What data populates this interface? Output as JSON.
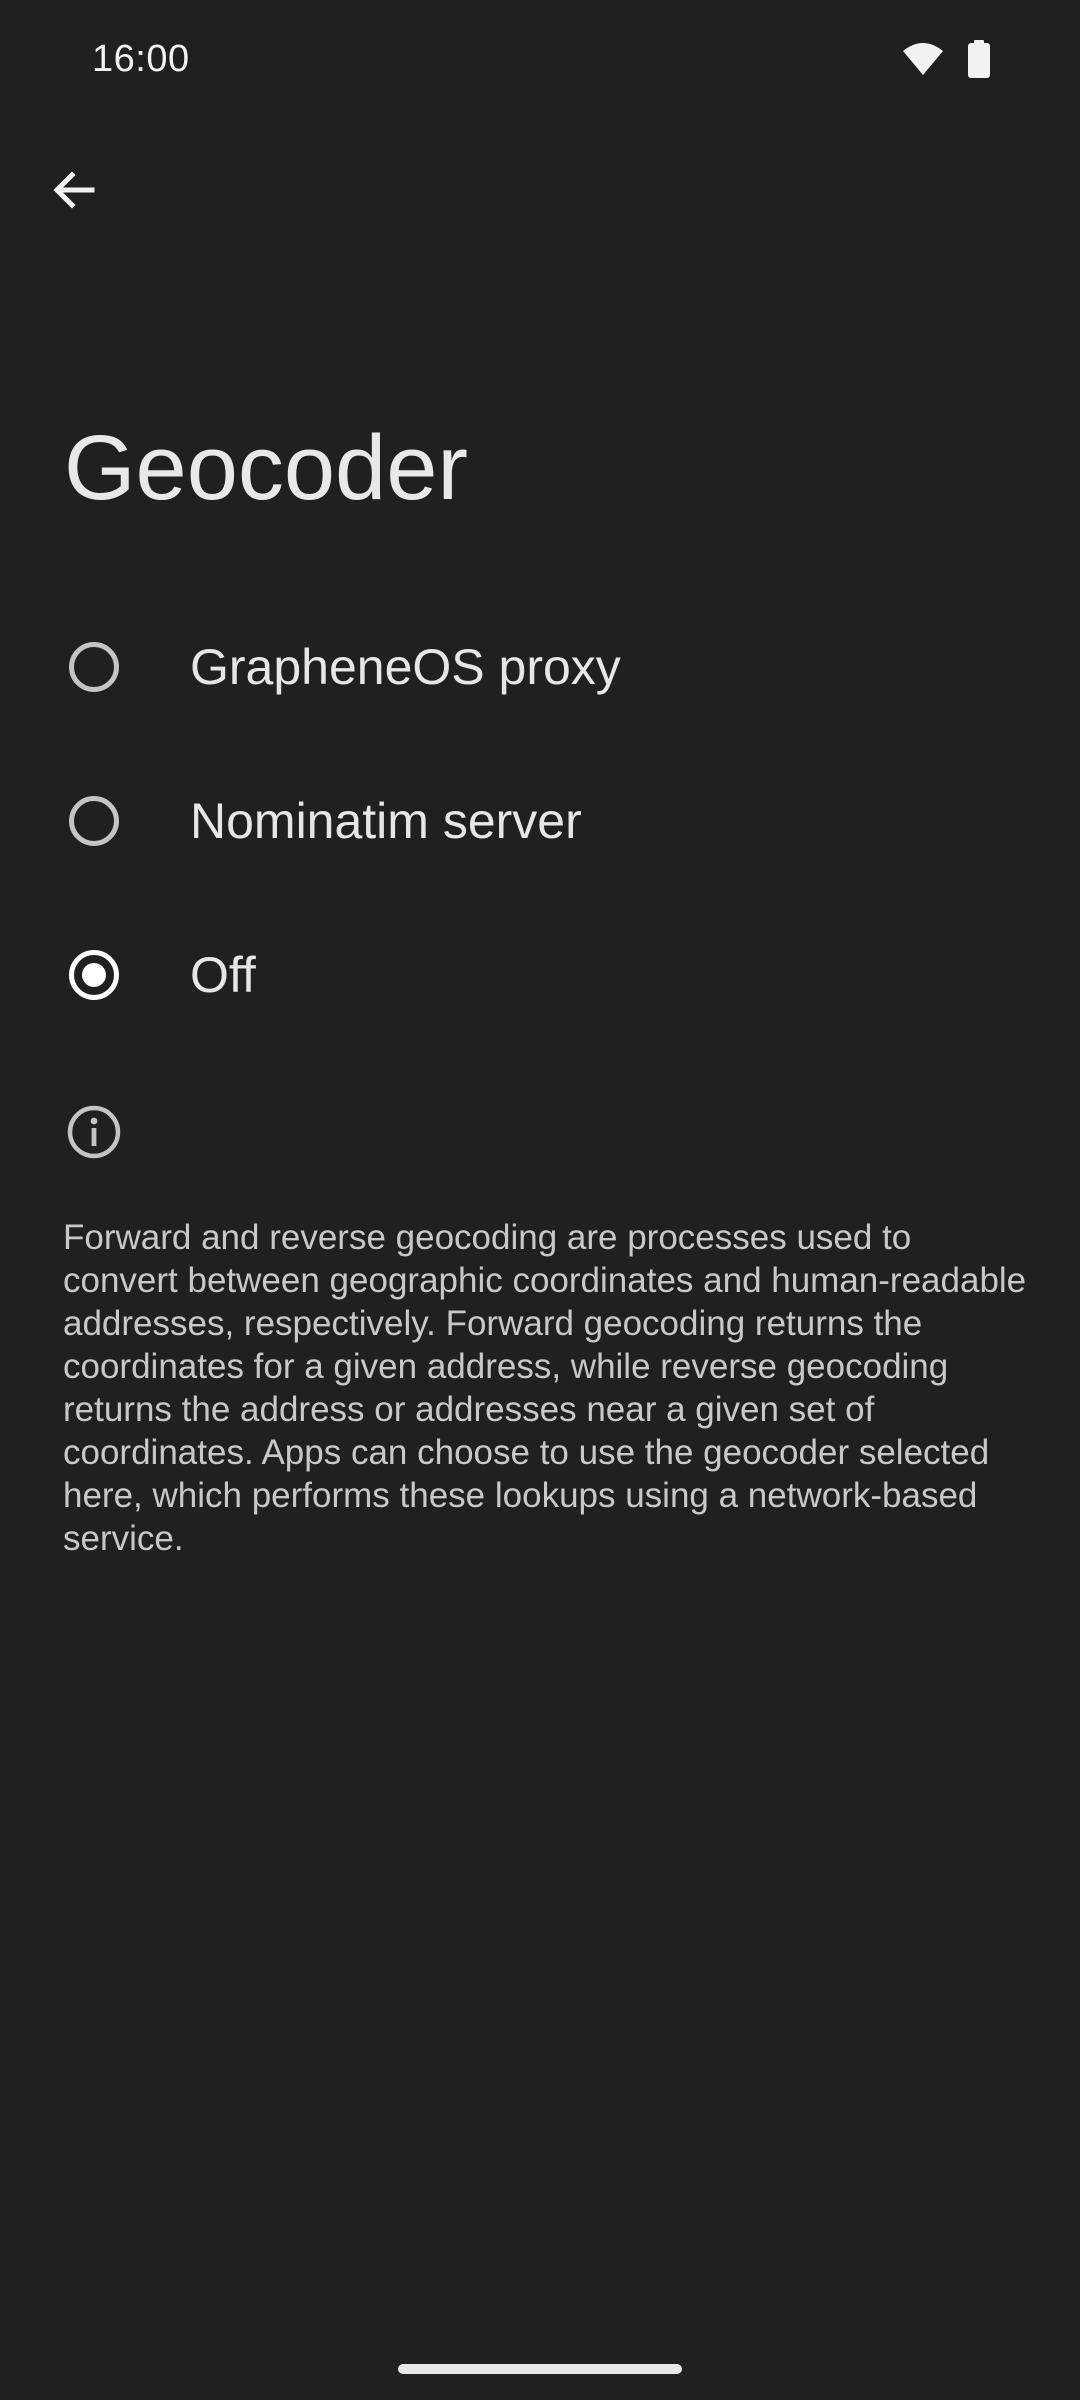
{
  "status_bar": {
    "time": "16:00",
    "icons": [
      "wifi-icon",
      "battery-icon"
    ]
  },
  "top_bar": {
    "back_icon": "arrow-back-icon"
  },
  "page": {
    "title": "Geocoder"
  },
  "options": [
    {
      "label": "GrapheneOS proxy",
      "checked": false
    },
    {
      "label": "Nominatim server",
      "checked": false
    },
    {
      "label": "Off",
      "checked": true
    }
  ],
  "info": {
    "icon": "info-icon",
    "description": "Forward and reverse geocoding are processes used to convert between geographic coordinates and human-readable addresses, respectively. Forward geocoding returns the coordinates for a given address, while reverse geocoding returns the address or addresses near a given set of coordinates. Apps can choose to use the geocoder selected here, which performs these lookups using a network-based service."
  },
  "colors": {
    "background": "#202020",
    "text_primary": "#e6e6e6",
    "text_secondary": "#c8c8c8"
  }
}
